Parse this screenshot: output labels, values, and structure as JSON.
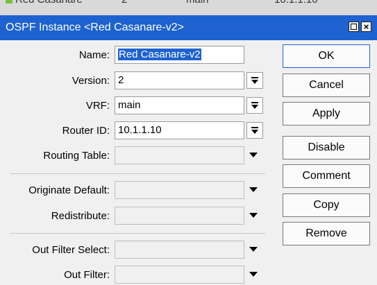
{
  "background_row": {
    "cells": [
      "Red Casanare",
      "2",
      "main",
      "10.1.1.10"
    ]
  },
  "window": {
    "title": "OSPF Instance <Red Casanare-v2>",
    "title_bar_color": "#1e62d0"
  },
  "form": {
    "name": {
      "label": "Name:",
      "value": "Red Casanare-v2"
    },
    "version": {
      "label": "Version:",
      "value": "2"
    },
    "vrf": {
      "label": "VRF:",
      "value": "main"
    },
    "router_id": {
      "label": "Router ID:",
      "value": "10.1.1.10"
    },
    "routing_table": {
      "label": "Routing Table:",
      "value": ""
    },
    "originate_default": {
      "label": "Originate Default:",
      "value": ""
    },
    "redistribute": {
      "label": "Redistribute:",
      "value": ""
    },
    "out_filter_select": {
      "label": "Out Filter Select:",
      "value": ""
    },
    "out_filter": {
      "label": "Out Filter:",
      "value": ""
    }
  },
  "buttons": {
    "ok": "OK",
    "cancel": "Cancel",
    "apply": "Apply",
    "disable": "Disable",
    "comment": "Comment",
    "copy": "Copy",
    "remove": "Remove"
  },
  "icons": [
    "restore-icon",
    "close-icon",
    "dropdown-arrow-icon"
  ]
}
